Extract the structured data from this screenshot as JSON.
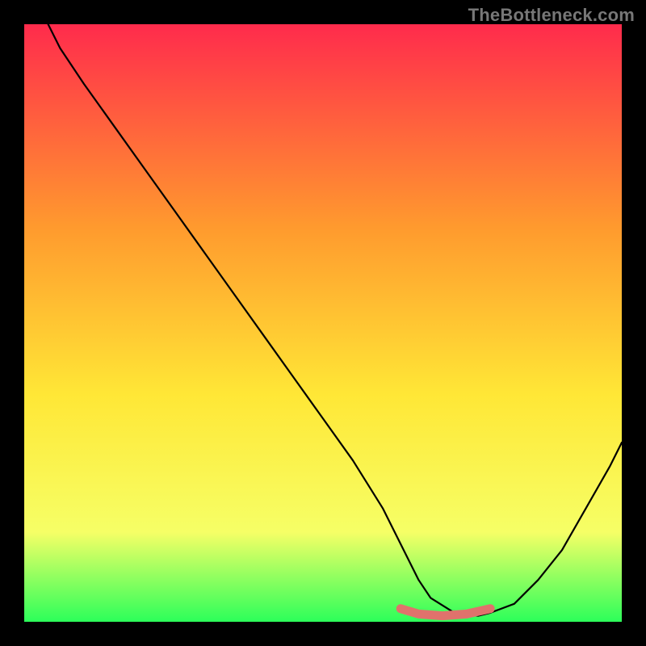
{
  "watermark": "TheBottleneck.com",
  "colors": {
    "frame_bg": "#000000",
    "grad_top": "#ff2b4c",
    "grad_mid1": "#ff9a2e",
    "grad_mid2": "#ffe736",
    "grad_low": "#f6ff66",
    "grad_bottom": "#2cff5a",
    "curve": "#000000",
    "highlight": "#e0726c"
  },
  "geometry": {
    "viewbox_w": 740,
    "viewbox_h": 740
  },
  "chart_data": {
    "type": "line",
    "title": "",
    "xlabel": "",
    "ylabel": "",
    "xlim": [
      0,
      100
    ],
    "ylim": [
      0,
      100
    ],
    "grid": false,
    "series": [
      {
        "name": "bottleneck-curve",
        "x": [
          4,
          6,
          10,
          15,
          20,
          25,
          30,
          35,
          40,
          45,
          50,
          55,
          60,
          64,
          66,
          68,
          72,
          76,
          78,
          82,
          86,
          90,
          94,
          98,
          100
        ],
        "y": [
          100,
          96,
          90,
          83,
          76,
          69,
          62,
          55,
          48,
          41,
          34,
          27,
          19,
          11,
          7,
          4,
          1.5,
          1,
          1.5,
          3,
          7,
          12,
          19,
          26,
          30
        ]
      },
      {
        "name": "minimum-band-highlight",
        "x": [
          63,
          66,
          70,
          74,
          78
        ],
        "y": [
          2.2,
          1.3,
          1.0,
          1.3,
          2.2
        ]
      }
    ],
    "annotations": []
  }
}
